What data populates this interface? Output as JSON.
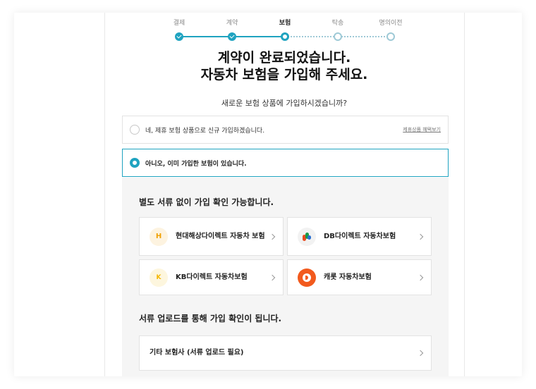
{
  "steps": [
    {
      "label": "결제",
      "state": "done"
    },
    {
      "label": "계약",
      "state": "done"
    },
    {
      "label": "보험",
      "state": "current"
    },
    {
      "label": "탁송",
      "state": "todo"
    },
    {
      "label": "명의이전",
      "state": "todo"
    }
  ],
  "title_line1": "계약이 완료되었습니다.",
  "title_line2": "자동차 보험을 가입해 주세요.",
  "subtitle": "새로운 보험 상품에 가입하시겠습니까?",
  "options": [
    {
      "label": "네, 제휴 보험 상품으로 신규 가입하겠습니다.",
      "link": "제휴상품 혜택보기",
      "selected": false
    },
    {
      "label": "아니오, 이미 가입한 보험이 있습니다.",
      "selected": true
    }
  ],
  "section1_title": "별도 서류 없이 가입 확인 가능합니다.",
  "insurers": [
    {
      "name": "현대해상다이렉트 자동차 보험",
      "icon": "hyundai-logo-icon",
      "mark": "H"
    },
    {
      "name": "DB다이렉트 자동차보험",
      "icon": "db-logo-icon"
    },
    {
      "name": "KB다이렉트 자동차보험",
      "icon": "kb-logo-icon",
      "mark": "K"
    },
    {
      "name": "캐롯 자동차보험",
      "icon": "carrot-logo-icon"
    }
  ],
  "section2_title": "서류 업로드를 통해 가입 확인이 됩니다.",
  "other_insurer": "기타 보험사 (서류 업로드 필요)",
  "colors": {
    "accent": "#1fa3c0",
    "panel": "#f5f5f5",
    "carrot": "#f25a1d"
  }
}
